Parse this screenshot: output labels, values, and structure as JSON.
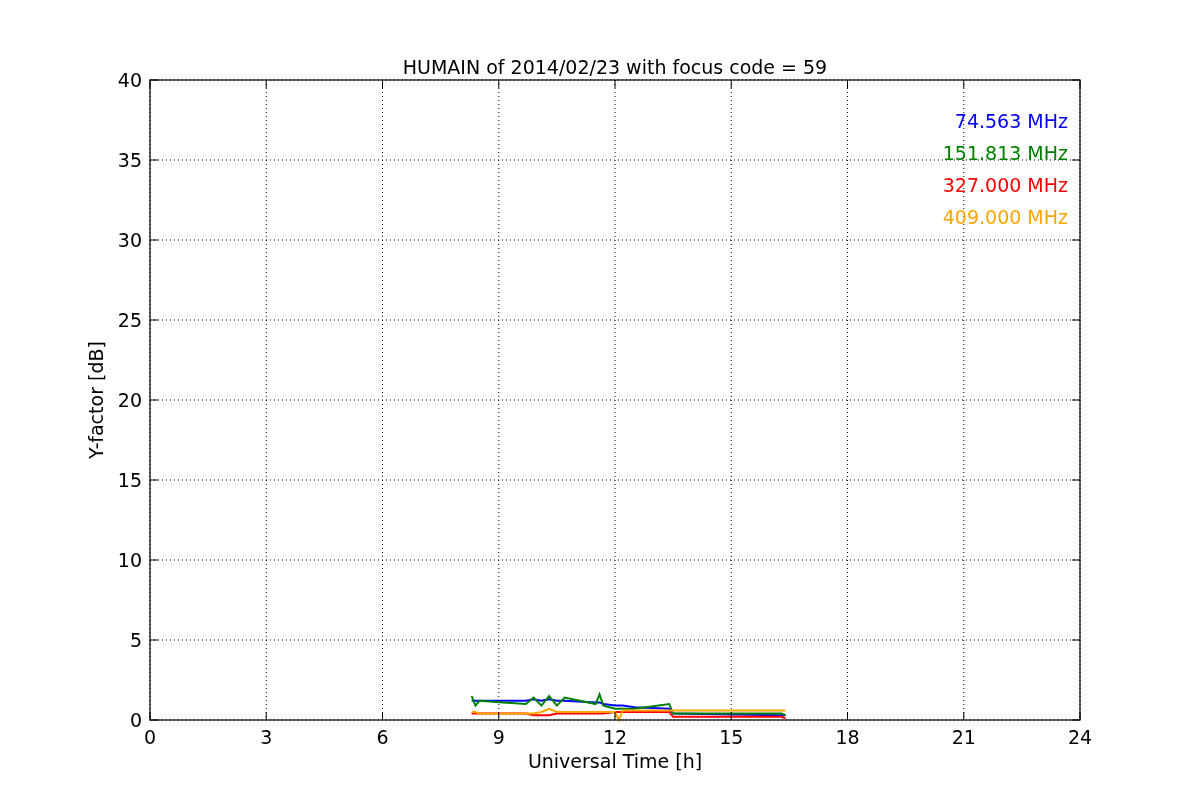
{
  "figure": {
    "chart_data": {
      "type": "line",
      "title": "HUMAIN of 2014/02/23 with focus code = 59",
      "xlabel": "Universal Time [h]",
      "ylabel": "Y-factor [dB]",
      "x": [
        8.3,
        8.4,
        8.5,
        9.7,
        9.9,
        10.1,
        10.3,
        10.5,
        10.7,
        11.5,
        11.6,
        11.7,
        12.0,
        12.1,
        12.2,
        12.5,
        13.4,
        13.5,
        16.3,
        16.4
      ],
      "series": [
        {
          "name": "74.563 MHz",
          "color": "#0000ff",
          "values": [
            1.2,
            1.2,
            1.2,
            1.2,
            1.3,
            1.2,
            1.3,
            1.2,
            1.2,
            1.1,
            1.1,
            1.0,
            0.9,
            0.9,
            0.9,
            0.8,
            0.7,
            0.4,
            0.3,
            0.3
          ]
        },
        {
          "name": "151.813 MHz",
          "color": "#008000",
          "values": [
            1.5,
            0.9,
            1.2,
            1.0,
            1.4,
            0.9,
            1.5,
            0.9,
            1.4,
            1.0,
            1.6,
            0.9,
            0.7,
            0.7,
            0.7,
            0.7,
            1.0,
            0.4,
            0.4,
            0.3
          ]
        },
        {
          "name": "327.000 MHz",
          "color": "#ff0000",
          "values": [
            0.4,
            0.4,
            0.4,
            0.4,
            0.3,
            0.3,
            0.3,
            0.4,
            0.4,
            0.4,
            0.4,
            0.4,
            0.5,
            0.5,
            0.5,
            0.5,
            0.5,
            0.2,
            0.2,
            0.1
          ]
        },
        {
          "name": "409.000 MHz",
          "color": "#ffa500",
          "values": [
            0.5,
            0.5,
            0.4,
            0.4,
            0.4,
            0.5,
            0.7,
            0.5,
            0.5,
            0.5,
            0.5,
            0.5,
            0.5,
            0.0,
            0.6,
            0.6,
            0.6,
            0.6,
            0.6,
            0.6
          ]
        }
      ],
      "xlim": [
        0,
        24
      ],
      "ylim": [
        0,
        40
      ],
      "xticks": [
        0,
        3,
        6,
        9,
        12,
        15,
        18,
        21,
        24
      ],
      "yticks": [
        0,
        5,
        10,
        15,
        20,
        25,
        30,
        35,
        40
      ],
      "grid": true
    }
  }
}
